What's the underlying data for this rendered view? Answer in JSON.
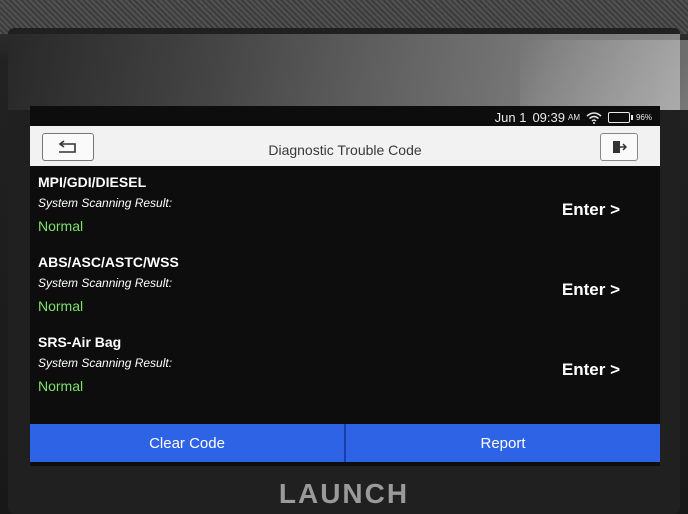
{
  "status": {
    "date": "Jun 1",
    "time": "09:39",
    "ampm": "AM",
    "battery": "96%"
  },
  "header": {
    "title": "Diagnostic Trouble Code",
    "back_icon": "back-arrow-icon",
    "exit_icon": "exit-icon"
  },
  "systems": [
    {
      "name": "MPI/GDI/DIESEL",
      "scan_label": "System Scanning Result:",
      "result": "Normal",
      "enter_label": "Enter >"
    },
    {
      "name": "ABS/ASC/ASTC/WSS",
      "scan_label": "System Scanning Result:",
      "result": "Normal",
      "enter_label": "Enter >"
    },
    {
      "name": "SRS-Air Bag",
      "scan_label": "System Scanning Result:",
      "result": "Normal",
      "enter_label": "Enter >"
    }
  ],
  "footer": {
    "clear_label": "Clear Code",
    "report_label": "Report"
  },
  "brand": "LAUNCH",
  "colors": {
    "accent": "#2f63e6",
    "result_ok": "#7ee06a",
    "header_bg": "#f2f2f2"
  }
}
